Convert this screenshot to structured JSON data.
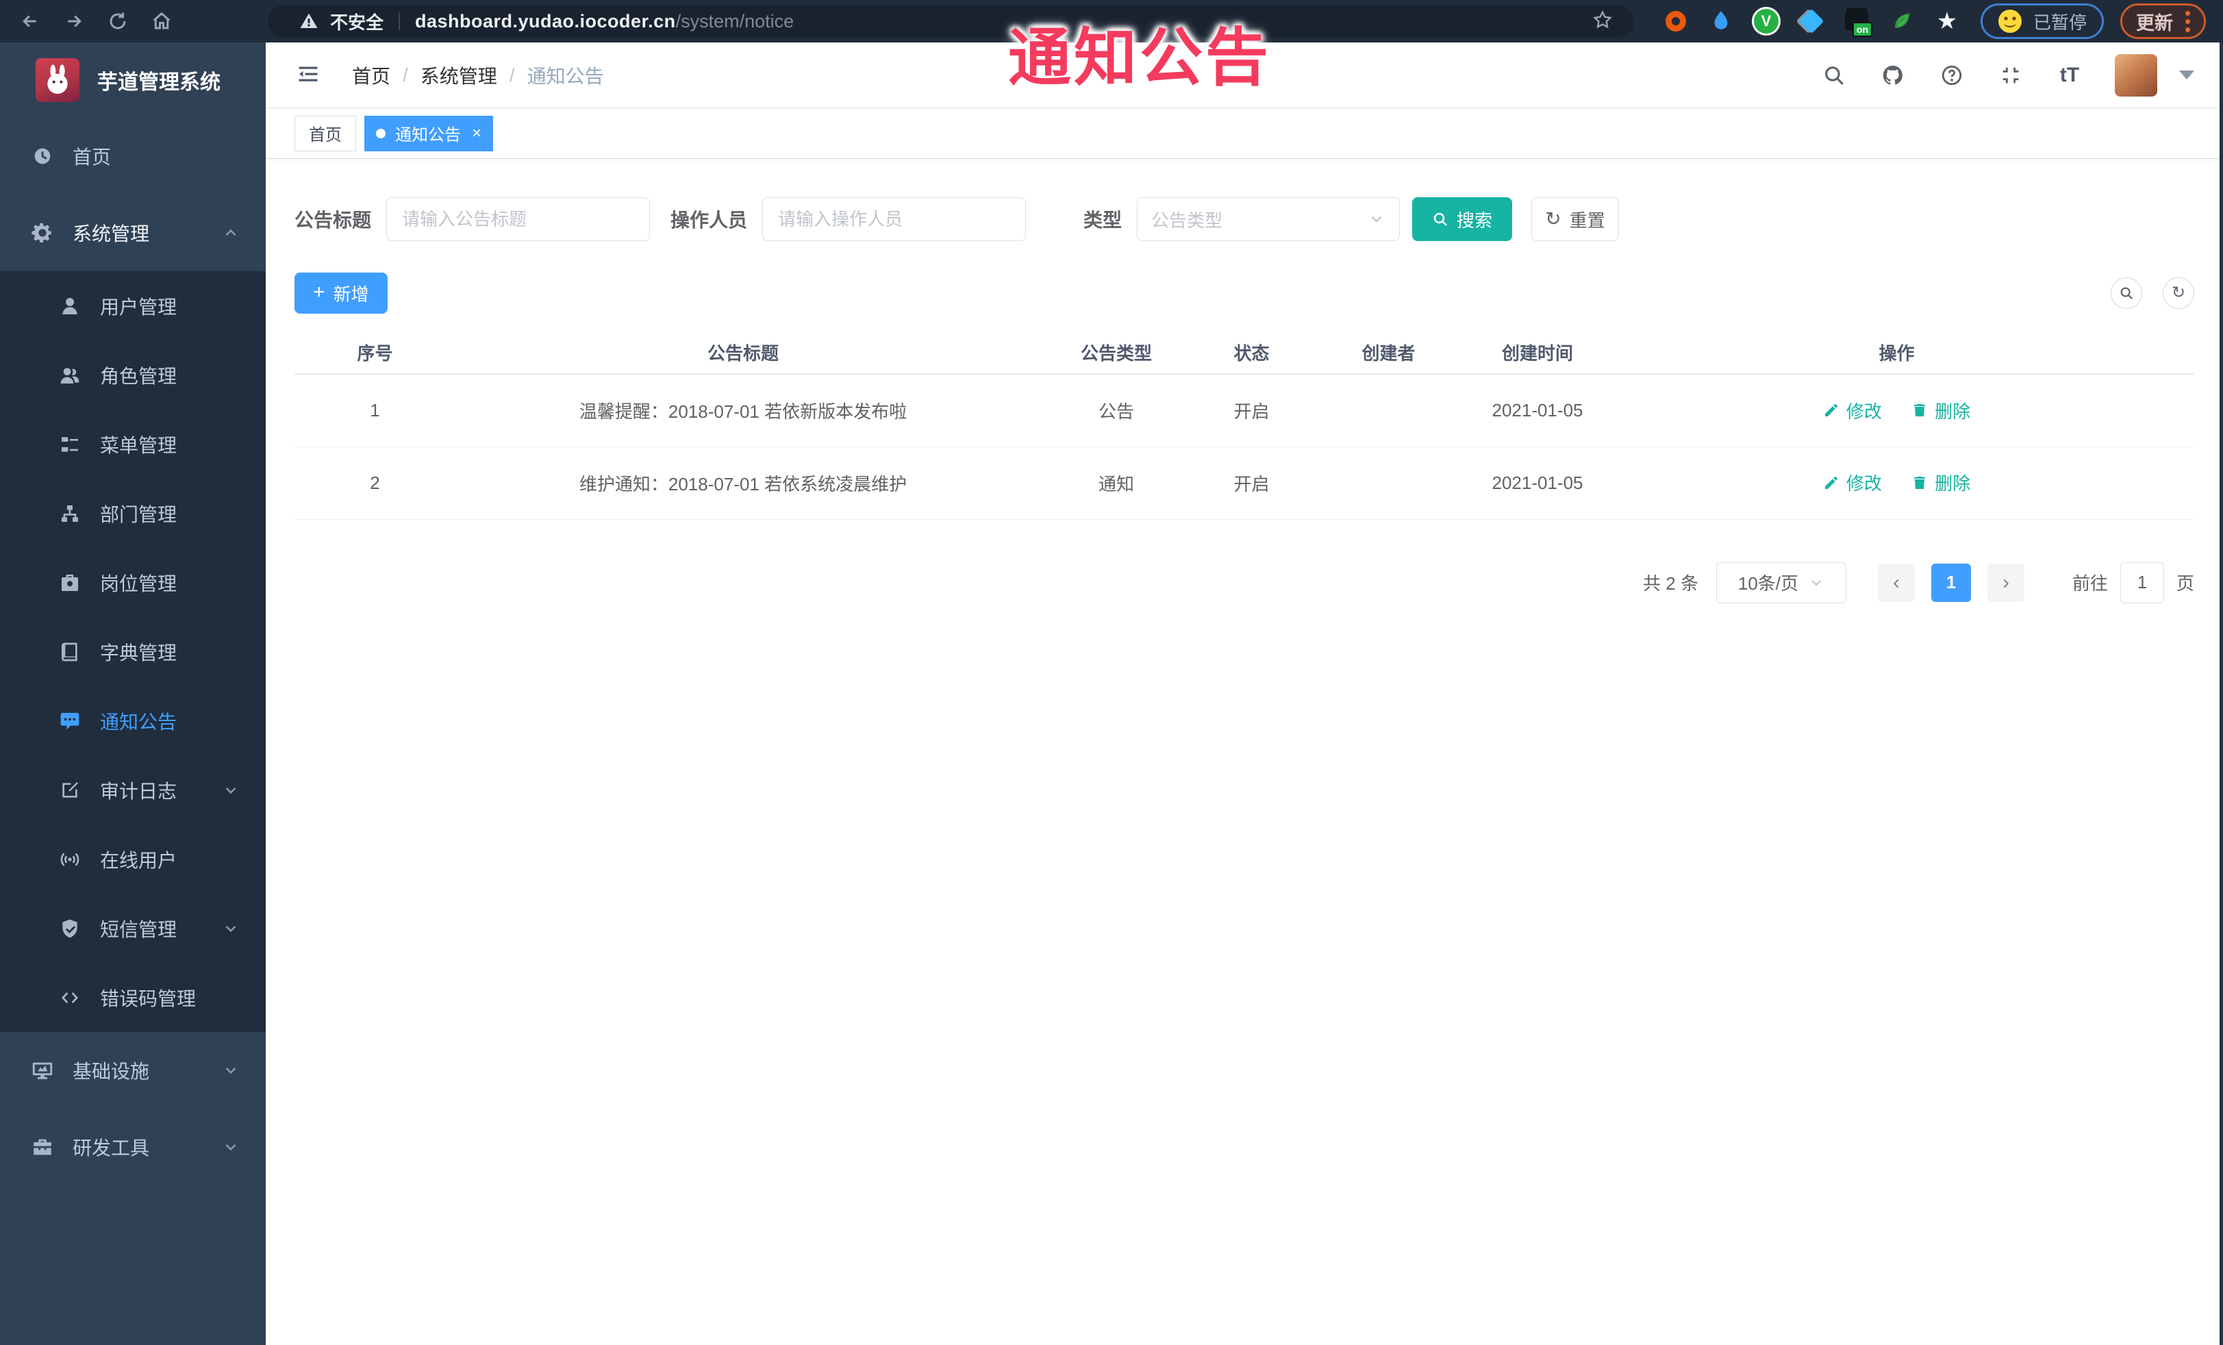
{
  "annotation": {
    "text": "通知公告"
  },
  "browser": {
    "insecure_label": "不安全",
    "url_host": "dashboard.yudao.iocoder.cn",
    "url_path": "/system/notice",
    "ext_v_label": "V",
    "ext_on_badge": "on",
    "paused_label": "已暂停",
    "update_label": "更新"
  },
  "sidebar": {
    "app_title": "芋道管理系统",
    "top_items": [
      {
        "label": "首页"
      },
      {
        "label": "系统管理"
      }
    ],
    "sub_items": [
      {
        "label": "用户管理"
      },
      {
        "label": "角色管理"
      },
      {
        "label": "菜单管理"
      },
      {
        "label": "部门管理"
      },
      {
        "label": "岗位管理"
      },
      {
        "label": "字典管理"
      },
      {
        "label": "通知公告"
      },
      {
        "label": "审计日志"
      },
      {
        "label": "在线用户"
      },
      {
        "label": "短信管理"
      },
      {
        "label": "错误码管理"
      }
    ],
    "bottom_items": [
      {
        "label": "基础设施"
      },
      {
        "label": "研发工具"
      }
    ]
  },
  "header": {
    "breadcrumb": [
      "首页",
      "系统管理",
      "通知公告"
    ],
    "font_size_icon": "tT",
    "tabs": [
      {
        "label": "首页"
      },
      {
        "label": "通知公告"
      }
    ]
  },
  "filters": {
    "title_label": "公告标题",
    "title_placeholder": "请输入公告标题",
    "operator_label": "操作人员",
    "operator_placeholder": "请输入操作人员",
    "type_label": "类型",
    "type_placeholder": "公告类型",
    "search_label": "搜索",
    "reset_label": "重置"
  },
  "toolbar": {
    "add_label": "新增"
  },
  "table": {
    "columns": [
      "序号",
      "公告标题",
      "公告类型",
      "状态",
      "创建者",
      "创建时间",
      "操作"
    ],
    "rows": [
      {
        "no": "1",
        "title": "温馨提醒：2018-07-01 若依新版本发布啦",
        "type": "公告",
        "status": "开启",
        "creator": "",
        "created": "2021-01-05"
      },
      {
        "no": "2",
        "title": "维护通知：2018-07-01 若依系统凌晨维护",
        "type": "通知",
        "status": "开启",
        "creator": "",
        "created": "2021-01-05"
      }
    ],
    "edit_label": "修改",
    "delete_label": "删除"
  },
  "pagination": {
    "total": "共 2 条",
    "page_size": "10条/页",
    "current_page": "1",
    "goto_label": "前往",
    "goto_value": "1",
    "page_unit": "页"
  },
  "colors": {
    "primary_blue": "#409eff",
    "search_teal": "#17b3a3",
    "sidebar_bg": "#304156",
    "submenu_bg": "#1f2d3d",
    "annotation_red": "#f43b5e"
  }
}
